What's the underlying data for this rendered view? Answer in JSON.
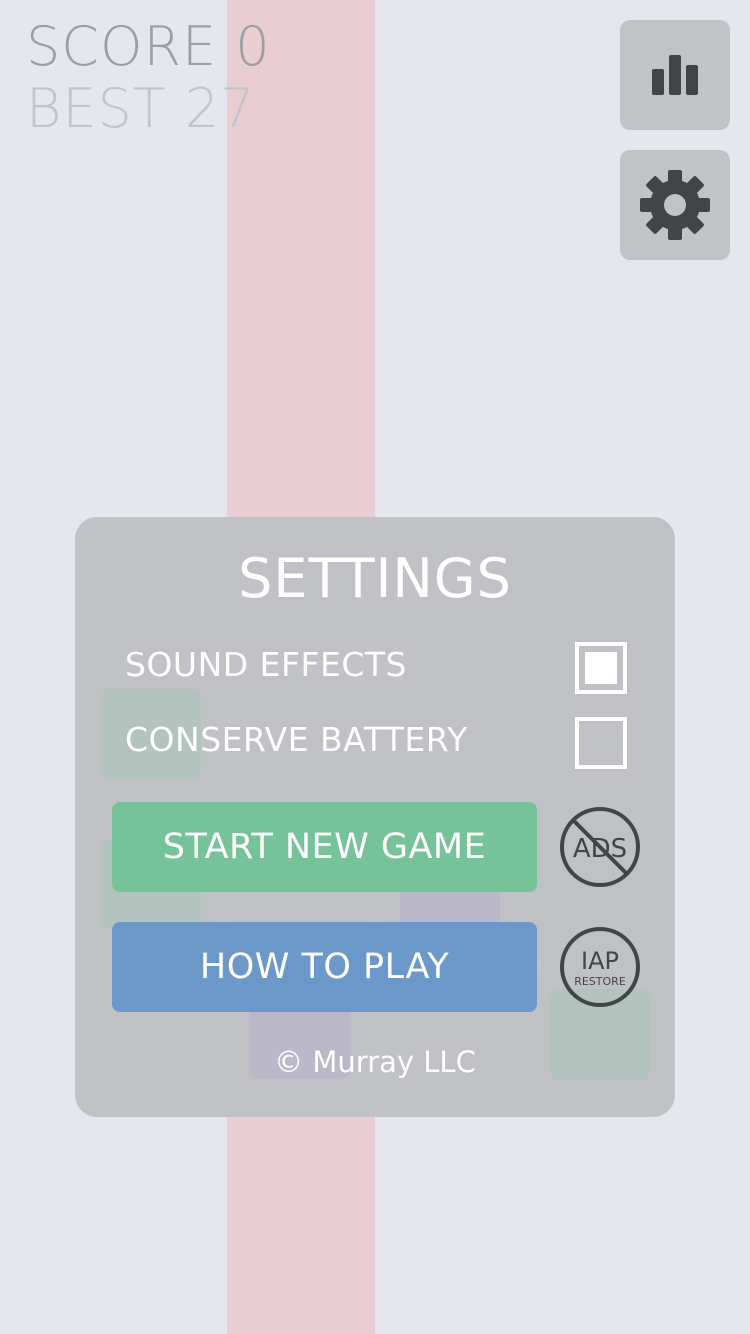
{
  "scoreboard": {
    "score_label": "SCORE 0",
    "best_label": "BEST 27"
  },
  "toolbar": {
    "stats_icon": "bar-chart-icon",
    "settings_icon": "gear-icon"
  },
  "settings": {
    "title": "SETTINGS",
    "options": [
      {
        "label": "SOUND EFFECTS",
        "checked": true
      },
      {
        "label": "CONSERVE BATTERY",
        "checked": false
      }
    ],
    "start_button": "START NEW GAME",
    "howto_button": "HOW TO PLAY",
    "no_ads_text": "ADS",
    "iap_text": "IAP",
    "iap_sub": "RESTORE",
    "copyright": "© Murray LLC"
  },
  "colors": {
    "background": "#e4e8ee",
    "stripe": "#e9cdd3",
    "start_green": "#76c39a",
    "howto_blue": "#6c97c9"
  }
}
